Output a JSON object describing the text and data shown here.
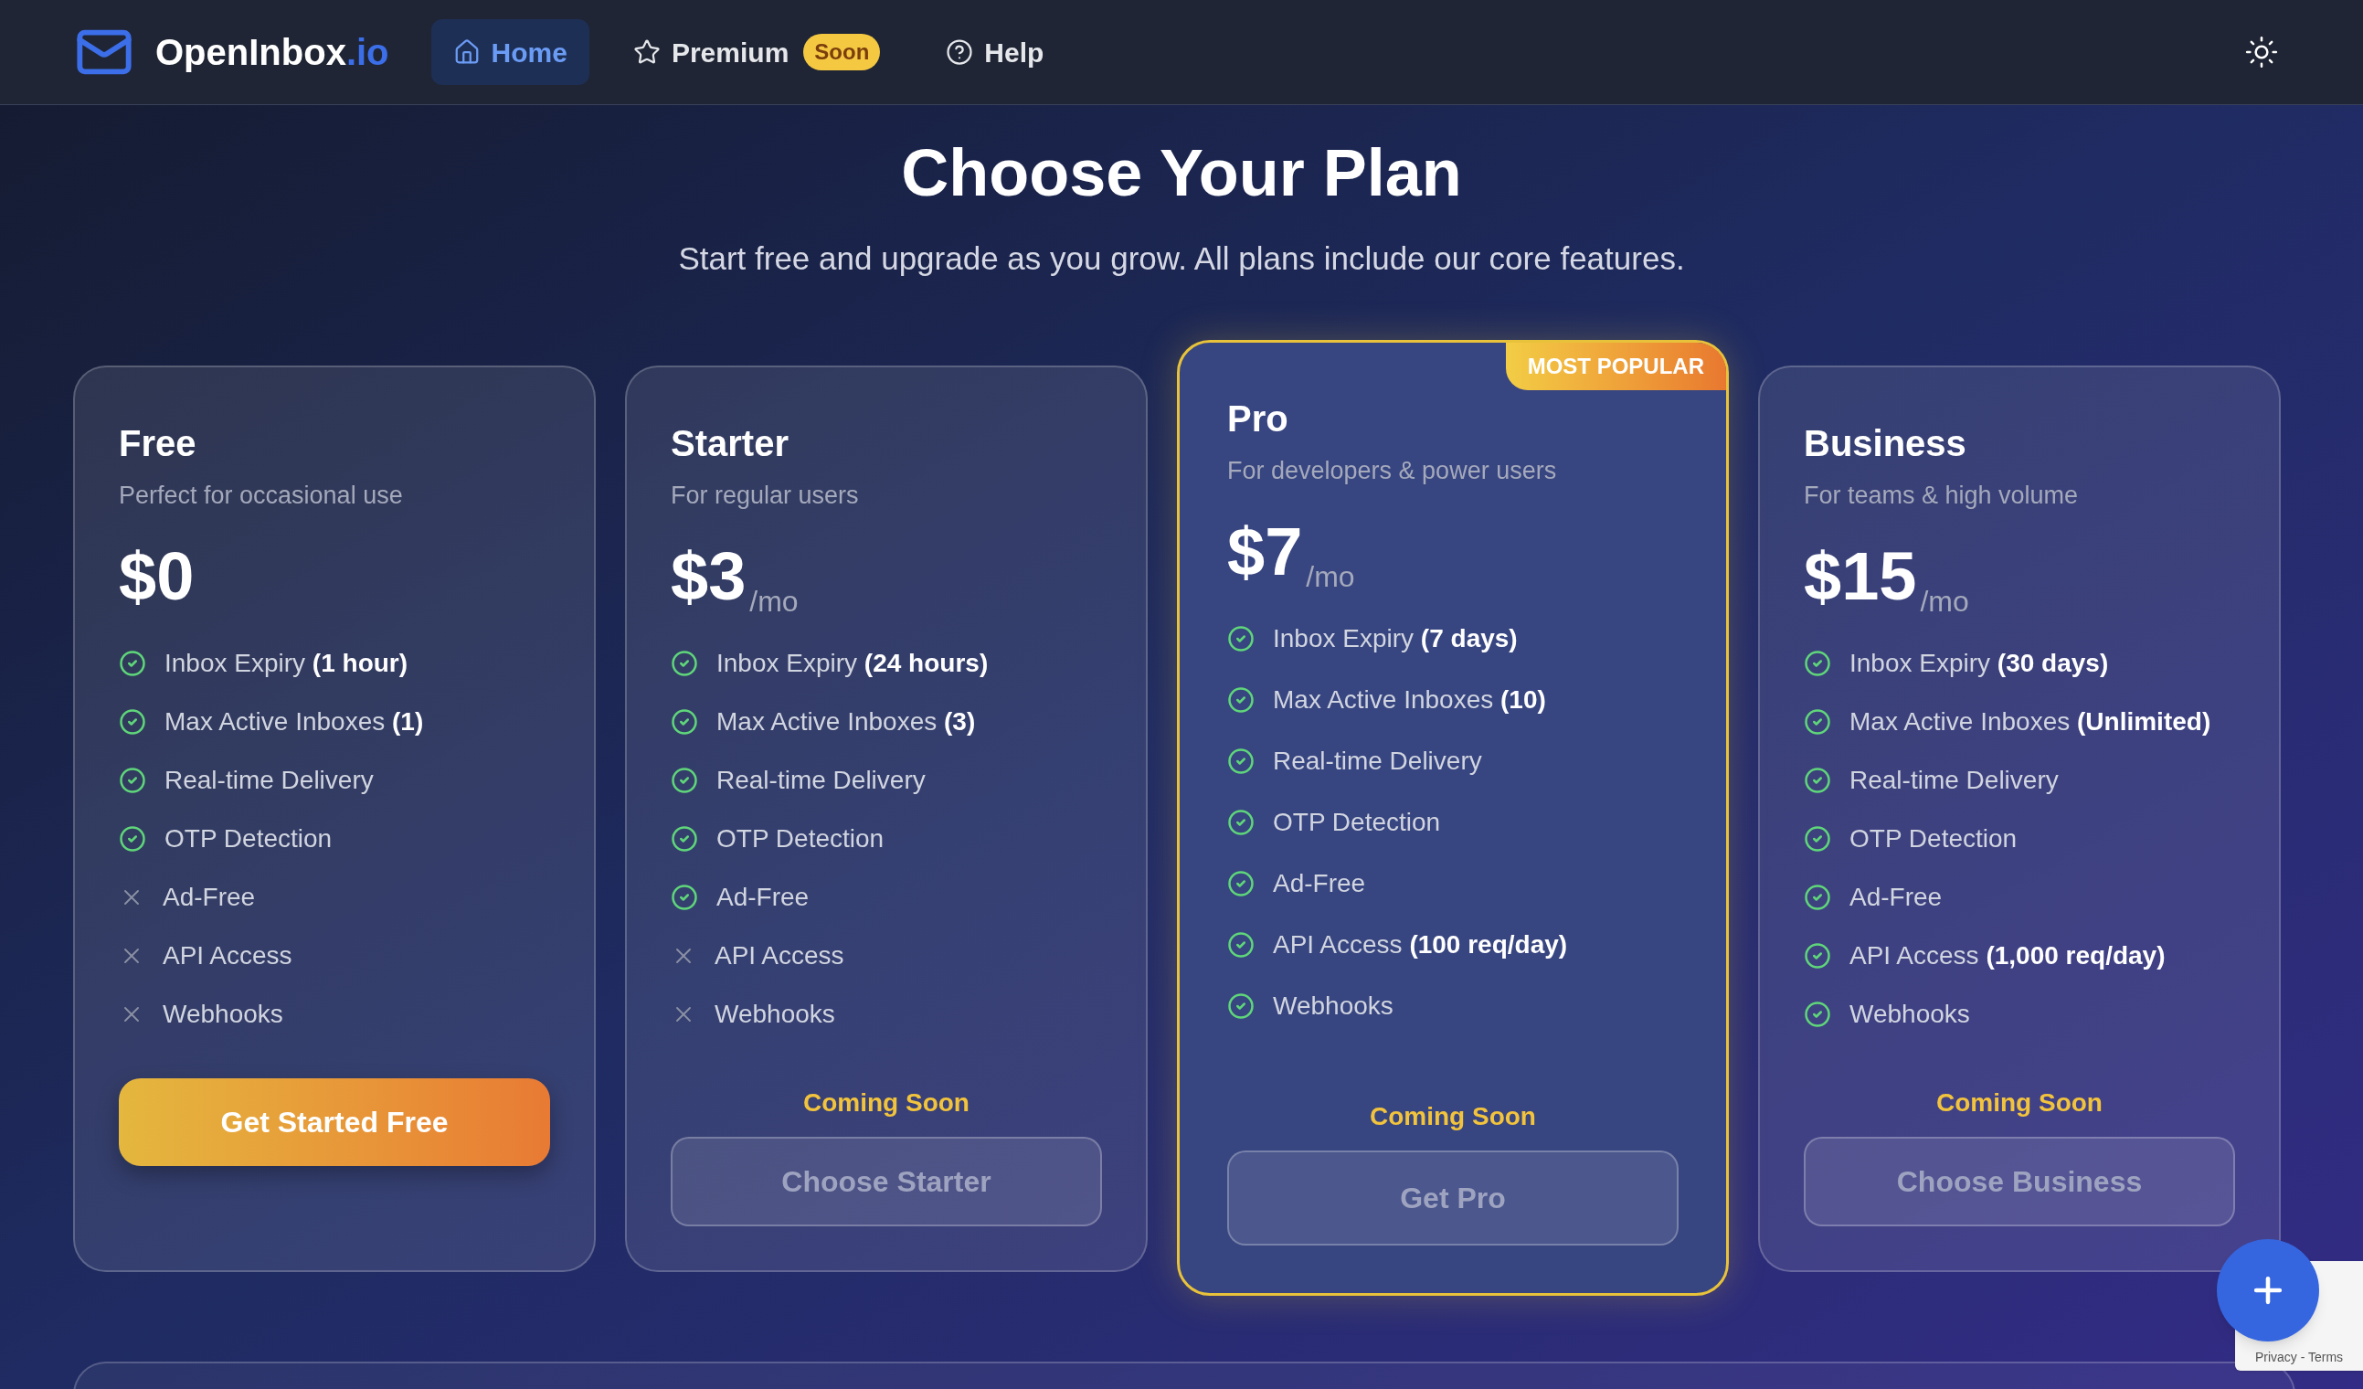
{
  "header": {
    "logo": {
      "name": "OpenInbox",
      "suffix": ".io"
    },
    "nav": [
      {
        "label": "Home",
        "kind": "home",
        "selected": true
      },
      {
        "label": "Premium",
        "kind": "premium",
        "badge": "Soon",
        "selected": false
      },
      {
        "label": "Help",
        "kind": "help",
        "selected": false
      }
    ]
  },
  "hero": {
    "title": "Choose Your Plan",
    "subtitle": "Start free and upgrade as you grow. All plans include our core features."
  },
  "plans": [
    {
      "name": "Free",
      "description": "Perfect for occasional use",
      "price": "$0",
      "featured": false,
      "features": [
        {
          "label": "Inbox Expiry",
          "value": "(1 hour)",
          "included": true
        },
        {
          "label": "Max Active Inboxes",
          "value": "(1)",
          "included": true
        },
        {
          "label": "Real-time Delivery",
          "included": true
        },
        {
          "label": "OTP Detection",
          "included": true
        },
        {
          "label": "Ad-Free",
          "included": false
        },
        {
          "label": "API Access",
          "included": false
        },
        {
          "label": "Webhooks",
          "included": false
        }
      ],
      "button": {
        "label": "Get Started Free",
        "kind": "primary"
      }
    },
    {
      "name": "Starter",
      "description": "For regular users",
      "price": "$3",
      "period": "/mo",
      "featured": false,
      "features": [
        {
          "label": "Inbox Expiry",
          "value": "(24 hours)",
          "included": true
        },
        {
          "label": "Max Active Inboxes",
          "value": "(3)",
          "included": true
        },
        {
          "label": "Real-time Delivery",
          "included": true
        },
        {
          "label": "OTP Detection",
          "included": true
        },
        {
          "label": "Ad-Free",
          "included": true
        },
        {
          "label": "API Access",
          "included": false
        },
        {
          "label": "Webhooks",
          "included": false
        }
      ],
      "note": "Coming Soon",
      "button": {
        "label": "Choose Starter",
        "kind": "disabled"
      }
    },
    {
      "name": "Pro",
      "description": "For developers & power users",
      "price": "$7",
      "period": "/mo",
      "featured": true,
      "badge": "MOST POPULAR",
      "features": [
        {
          "label": "Inbox Expiry",
          "value": "(7 days)",
          "included": true
        },
        {
          "label": "Max Active Inboxes",
          "value": "(10)",
          "included": true
        },
        {
          "label": "Real-time Delivery",
          "included": true
        },
        {
          "label": "OTP Detection",
          "included": true
        },
        {
          "label": "Ad-Free",
          "included": true
        },
        {
          "label": "API Access",
          "value": "(100 req/day)",
          "included": true
        },
        {
          "label": "Webhooks",
          "included": true
        }
      ],
      "note": "Coming Soon",
      "button": {
        "label": "Get Pro",
        "kind": "disabled"
      }
    },
    {
      "name": "Business",
      "description": "For teams & high volume",
      "price": "$15",
      "period": "/mo",
      "featured": false,
      "features": [
        {
          "label": "Inbox Expiry",
          "value": "(30 days)",
          "included": true
        },
        {
          "label": "Max Active Inboxes",
          "value": "(Unlimited)",
          "included": true
        },
        {
          "label": "Real-time Delivery",
          "included": true
        },
        {
          "label": "OTP Detection",
          "included": true
        },
        {
          "label": "Ad-Free",
          "included": true
        },
        {
          "label": "API Access",
          "value": "(1,000 req/day)",
          "included": true
        },
        {
          "label": "Webhooks",
          "included": true
        }
      ],
      "note": "Coming Soon",
      "button": {
        "label": "Choose Business",
        "kind": "disabled"
      }
    }
  ],
  "recaptcha": {
    "links": "Privacy - Terms"
  }
}
